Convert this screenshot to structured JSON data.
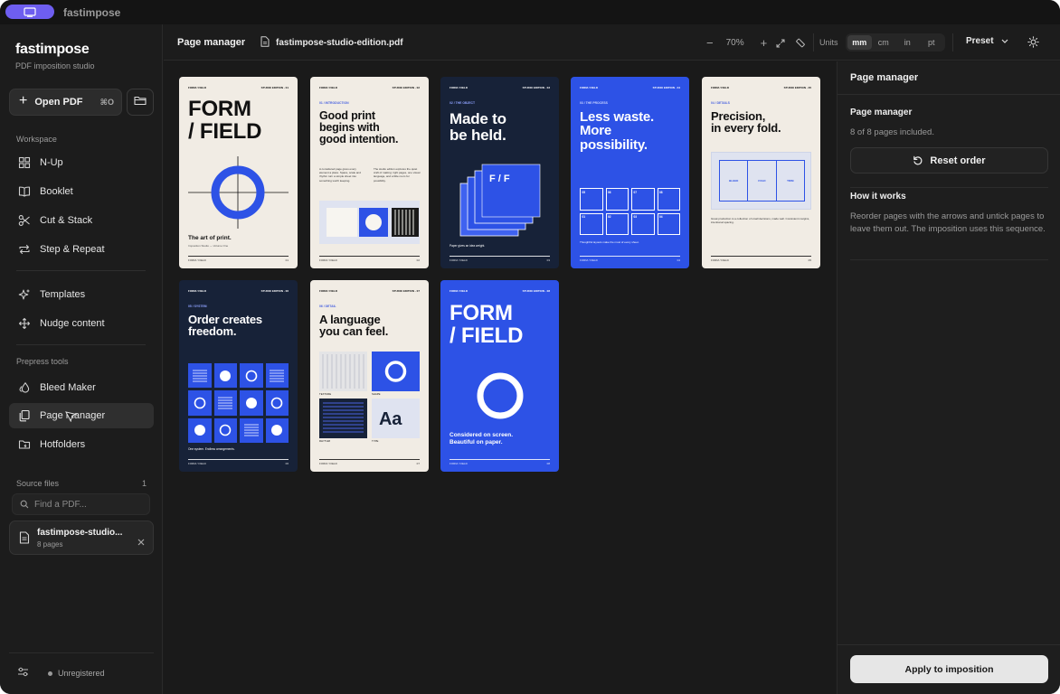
{
  "titlebar": {
    "app_name": "fastimpose",
    "app_icon": "monitor-icon"
  },
  "sidebar": {
    "brand": "fastimpose",
    "brand_sub": "PDF imposition studio",
    "open_pdf": {
      "label": "Open PDF",
      "shortcut": "⌘O"
    },
    "workspace_label": "Workspace",
    "workspace_items": [
      {
        "label": "N-Up",
        "icon": "grid-icon"
      },
      {
        "label": "Booklet",
        "icon": "book-icon"
      },
      {
        "label": "Cut & Stack",
        "icon": "scissors-icon"
      },
      {
        "label": "Step & Repeat",
        "icon": "repeat-icon"
      }
    ],
    "extra_items": [
      {
        "label": "Templates",
        "icon": "sparkle-icon"
      },
      {
        "label": "Nudge content",
        "icon": "move-icon"
      }
    ],
    "prepress_label": "Prepress tools",
    "prepress_items": [
      {
        "label": "Bleed Maker",
        "icon": "drop-icon"
      },
      {
        "label": "Page manager",
        "icon": "pages-icon"
      },
      {
        "label": "Hotfolders",
        "icon": "folder-icon"
      }
    ],
    "source_files_label": "Source files",
    "source_files_count": "1",
    "search_placeholder": "Find a PDF...",
    "file": {
      "name": "fastimpose-studio...",
      "pages": "8 pages"
    },
    "status": "Unregistered"
  },
  "header": {
    "title": "Page manager",
    "filename": "fastimpose-studio-edition.pdf",
    "zoom_minus": "−",
    "zoom": "70%",
    "zoom_plus": "+",
    "units_label": "Units",
    "units": [
      "mm",
      "cm",
      "in",
      "pt"
    ],
    "units_selected": "mm",
    "preset": "Preset"
  },
  "pages": [
    {
      "top_l": "FORM / FIELD",
      "top_r": "STUDIO EDITION · 01",
      "h1": "FORM",
      "h2": "/ FIELD",
      "caption": "The art of print.",
      "note": "Imposition Studio — Volume One",
      "foot_l": "FORM / FIELD",
      "foot_r": "01"
    },
    {
      "top_l": "FORM / FIELD",
      "top_r": "STUDIO EDITION · 02",
      "kicker": "01 / INTRODUCTION",
      "h1": "Good print",
      "h2": "begins with",
      "h3": "good intention.",
      "col1": "A considered page gives every element a place. Space, scale and rhythm turn a simple sheet into something worth keeping.",
      "col2": "The studio edition explores the quiet craft of making: right pages, one visual language, and a little room for possibility.",
      "foot_l": "FORM / FIELD",
      "foot_r": "02"
    },
    {
      "top_l": "FORM / FIELD",
      "top_r": "STUDIO EDITION · 03",
      "kicker": "02 / THE OBJECT",
      "h1": "Made to",
      "h2": "be held.",
      "ff": "F / F",
      "caption": "Paper gives an idea weight.",
      "foot_l": "FORM / FIELD",
      "foot_r": "03"
    },
    {
      "top_l": "FORM / FIELD",
      "top_r": "STUDIO EDITION · 04",
      "kicker": "03 / THE PROCESS",
      "h1": "Less waste.",
      "h2": "More",
      "h3": "possibility.",
      "cells": [
        "05",
        "06",
        "07",
        "08",
        "01",
        "02",
        "03",
        "04"
      ],
      "caption": "Thoughtful layouts make the most of every sheet.",
      "foot_l": "FORM / FIELD",
      "foot_r": "04"
    },
    {
      "top_l": "FORM / FIELD",
      "top_r": "STUDIO EDITION · 05",
      "kicker": "04 / DETAILS",
      "h1": "Precision,",
      "h2": "in every fold.",
      "panels": [
        "BLEED",
        "FOLD",
        "TRIM"
      ],
      "caption": "Great production is a collection of small decisions, made well. Consistent margins, intentional spacing.",
      "foot_l": "FORM / FIELD",
      "foot_r": "05"
    },
    {
      "top_l": "FORM / FIELD",
      "top_r": "STUDIO EDITION · 06",
      "kicker": "05 / SYSTEM",
      "h1": "Order creates",
      "h2": "freedom.",
      "caption": "One system. Endless arrangements.",
      "foot_l": "FORM / FIELD",
      "foot_r": "06"
    },
    {
      "top_l": "FORM / FIELD",
      "top_r": "STUDIO EDITION · 07",
      "kicker": "06 / DETAIL",
      "h1": "A language",
      "h2": "you can feel.",
      "labels": [
        "TEXTURE",
        "SHAPE",
        "RHYTHM",
        "TYPE"
      ],
      "aa": "Aa",
      "foot_l": "FORM / FIELD",
      "foot_r": "07"
    },
    {
      "top_l": "FORM / FIELD",
      "top_r": "STUDIO EDITION · 08",
      "h1": "FORM",
      "h2": "/ FIELD",
      "caption1": "Considered on screen.",
      "caption2": "Beautiful on paper.",
      "foot_l": "FORM / FIELD",
      "foot_r": "08"
    }
  ],
  "right_panel": {
    "title": "Page manager",
    "section_title": "Page manager",
    "included": "8 of 8 pages included.",
    "reset_label": "Reset order",
    "how_title": "How it works",
    "how_text": "Reorder pages with the arrows and untick pages to leave them out. The imposition uses this sequence.",
    "apply_label": "Apply to imposition"
  },
  "colors": {
    "accent": "#2d52e6",
    "navy": "#172238",
    "cream": "#f1ece4",
    "pill": "#6e5ef0"
  }
}
